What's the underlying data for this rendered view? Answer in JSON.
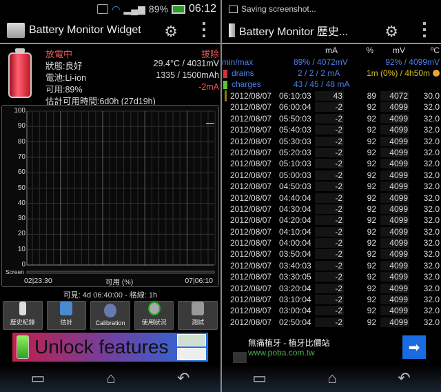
{
  "left": {
    "status": {
      "battery_pct": "89%",
      "time": "06:12"
    },
    "title": "Battery Monitor Widget",
    "info": {
      "state": "放電中",
      "unplug": "拔除",
      "health": "狀態:良好",
      "temp_voltage": "29.4°C / 4031mV",
      "battery_type": "電池:Li-ion",
      "capacity": "1335 / 1500mAh",
      "available": "可用:89%",
      "current": "-2mA",
      "estimate": "估計可用時間:6d0h (27d19h)"
    },
    "visible_text": "可見: 4d 06:40:00 - 格線: 1h",
    "buttons": [
      {
        "label": "歷史紀錄"
      },
      {
        "label": "估計"
      },
      {
        "label": "Calibration"
      },
      {
        "label": "使用狀況"
      },
      {
        "label": "測試"
      }
    ],
    "ad": "Unlock features"
  },
  "chart_data": {
    "type": "line",
    "title": "",
    "xlabel": "可用 (%)",
    "ylabel": "",
    "ylim": [
      0,
      100
    ],
    "yticks": [
      "0",
      "10",
      "20",
      "30",
      "40",
      "50",
      "60",
      "70",
      "80",
      "90",
      "100"
    ],
    "x_start": "02|23:30",
    "x_end": "07|06:10",
    "screen_label": "Screen",
    "series": [
      {
        "name": "可用 (%)",
        "values": [
          92,
          92
        ]
      }
    ],
    "grid": true,
    "accent": "#ffffff"
  },
  "right": {
    "status_text": "Saving screenshot...",
    "title": "Battery Monitor 歷史...",
    "headers": {
      "ma": "mA",
      "pct": "%",
      "mv": "mV",
      "c": "ºC"
    },
    "minmax": {
      "label": "min/max",
      "min": "89% / 4072mV",
      "max": "92% / 4099mV"
    },
    "drains": {
      "label": "drains",
      "value": "2 / 2 / 2 mA",
      "time": "1m (0%) / 4h50m"
    },
    "charges": {
      "label": "charges",
      "value": "43 / 45 / 48 mA"
    },
    "rows": [
      {
        "date": "2012/08/07",
        "time": "06:10:03",
        "ma": "43",
        "pct": "89",
        "mv": "4072",
        "c": "30.0"
      },
      {
        "date": "2012/08/07",
        "time": "06:00:04",
        "ma": "-2",
        "pct": "92",
        "mv": "4099",
        "c": "32.0"
      },
      {
        "date": "2012/08/07",
        "time": "05:50:03",
        "ma": "-2",
        "pct": "92",
        "mv": "4099",
        "c": "32.0"
      },
      {
        "date": "2012/08/07",
        "time": "05:40:03",
        "ma": "-2",
        "pct": "92",
        "mv": "4099",
        "c": "32.0"
      },
      {
        "date": "2012/08/07",
        "time": "05:30:03",
        "ma": "-2",
        "pct": "92",
        "mv": "4099",
        "c": "32.0"
      },
      {
        "date": "2012/08/07",
        "time": "05:20:03",
        "ma": "-2",
        "pct": "92",
        "mv": "4099",
        "c": "32.0"
      },
      {
        "date": "2012/08/07",
        "time": "05:10:03",
        "ma": "-2",
        "pct": "92",
        "mv": "4099",
        "c": "32.0"
      },
      {
        "date": "2012/08/07",
        "time": "05:00:03",
        "ma": "-2",
        "pct": "92",
        "mv": "4099",
        "c": "32.0"
      },
      {
        "date": "2012/08/07",
        "time": "04:50:03",
        "ma": "-2",
        "pct": "92",
        "mv": "4099",
        "c": "32.0"
      },
      {
        "date": "2012/08/07",
        "time": "04:40:04",
        "ma": "-2",
        "pct": "92",
        "mv": "4099",
        "c": "32.0"
      },
      {
        "date": "2012/08/07",
        "time": "04:30:04",
        "ma": "-2",
        "pct": "92",
        "mv": "4099",
        "c": "32.0"
      },
      {
        "date": "2012/08/07",
        "time": "04:20:04",
        "ma": "-2",
        "pct": "92",
        "mv": "4099",
        "c": "32.0"
      },
      {
        "date": "2012/08/07",
        "time": "04:10:04",
        "ma": "-2",
        "pct": "92",
        "mv": "4099",
        "c": "32.0"
      },
      {
        "date": "2012/08/07",
        "time": "04:00:04",
        "ma": "-2",
        "pct": "92",
        "mv": "4099",
        "c": "32.0"
      },
      {
        "date": "2012/08/07",
        "time": "03:50:04",
        "ma": "-2",
        "pct": "92",
        "mv": "4099",
        "c": "32.0"
      },
      {
        "date": "2012/08/07",
        "time": "03:40:03",
        "ma": "-2",
        "pct": "92",
        "mv": "4099",
        "c": "32.0"
      },
      {
        "date": "2012/08/07",
        "time": "03:30:05",
        "ma": "-2",
        "pct": "92",
        "mv": "4099",
        "c": "32.0"
      },
      {
        "date": "2012/08/07",
        "time": "03:20:04",
        "ma": "-2",
        "pct": "92",
        "mv": "4099",
        "c": "32.0"
      },
      {
        "date": "2012/08/07",
        "time": "03:10:04",
        "ma": "-2",
        "pct": "92",
        "mv": "4099",
        "c": "32.0"
      },
      {
        "date": "2012/08/07",
        "time": "03:00:04",
        "ma": "-2",
        "pct": "92",
        "mv": "4099",
        "c": "32.0"
      },
      {
        "date": "2012/08/07",
        "time": "02:50:04",
        "ma": "-2",
        "pct": "92",
        "mv": "4099",
        "c": "32.0"
      }
    ],
    "ad": {
      "title": "無痛植牙 - 植牙比價站",
      "url": "www.poba.com.tw"
    }
  }
}
